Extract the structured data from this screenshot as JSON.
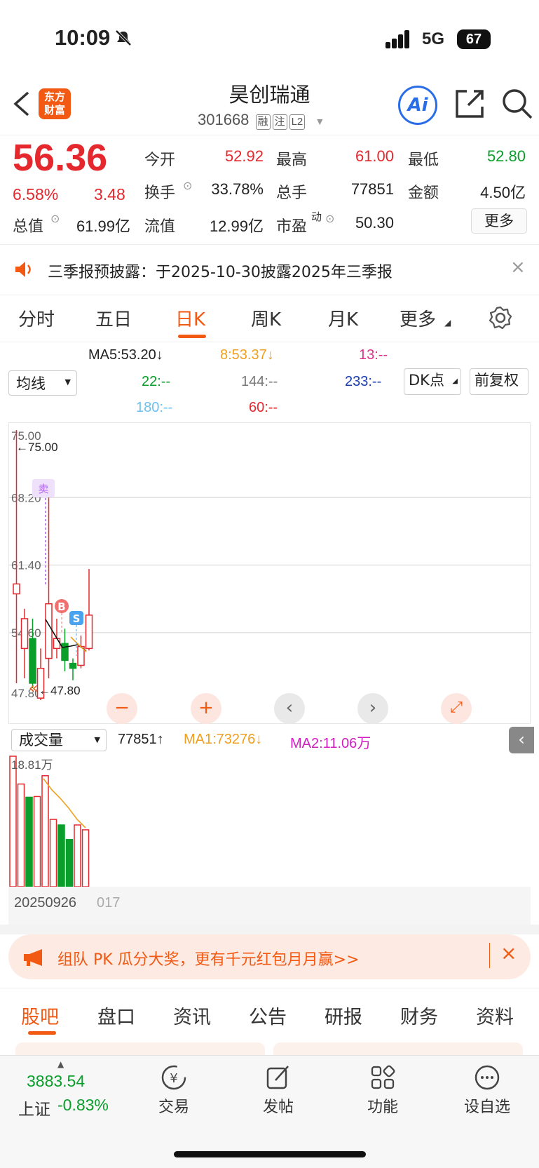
{
  "status": {
    "time": "10:09",
    "network": "5G",
    "battery": "67"
  },
  "header": {
    "logo": "东方财富",
    "name": "昊创瑞通",
    "code": "301668",
    "tags": [
      "融",
      "注",
      "L2"
    ],
    "ai": "Ai"
  },
  "quote": {
    "price": "56.36",
    "pct": "6.58%",
    "chg": "3.48",
    "open_l": "今开",
    "open": "52.92",
    "high_l": "最高",
    "high": "61.00",
    "low_l": "最低",
    "low": "52.80",
    "turn_l": "换手",
    "turn": "33.78%",
    "vol_l": "总手",
    "vol": "77851",
    "amt_l": "金额",
    "amt": "4.50亿",
    "cap_l": "总值",
    "cap": "61.99亿",
    "flt_l": "流值",
    "flt": "12.99亿",
    "pe_l": "市盈",
    "pe_sup": "动",
    "pe": "50.30",
    "more": "更多"
  },
  "notice": {
    "text": "三季报预披露：于2025-10-30披露2025年三季报"
  },
  "tabs": [
    "分时",
    "五日",
    "日K",
    "周K",
    "月K",
    "更多",
    "设置"
  ],
  "ma": {
    "ma5": "MA5:53.20↓",
    "ma8": "8:53.37↓",
    "ma13": "13:--",
    "ma22": "22:--",
    "ma144": "144:--",
    "ma233": "233:--",
    "ma180": "180:--",
    "ma60": "60:--",
    "sel": "均线",
    "dk": "DK点",
    "fq": "前复权"
  },
  "chart_data": {
    "type": "candlestick",
    "yticks": [
      "75.00",
      "68.20",
      "61.40",
      "54.60",
      "47.80"
    ],
    "ylim": [
      47.8,
      75.0
    ],
    "max_label": "←75.00",
    "min_label": "←47.80",
    "markers": [
      "B",
      "S",
      "卖"
    ],
    "candles": [
      {
        "o": 59.5,
        "c": 58.5,
        "h": 75.0,
        "l": 49.5,
        "up": true
      },
      {
        "o": 56,
        "c": 53,
        "h": 57,
        "l": 50,
        "up": true
      },
      {
        "o": 54,
        "c": 49.5,
        "h": 56,
        "l": 49,
        "up": false
      },
      {
        "o": 51,
        "c": 48,
        "h": 53,
        "l": 47.8,
        "up": true
      },
      {
        "o": 52,
        "c": 57.5,
        "h": 68.2,
        "l": 50,
        "up": true
      },
      {
        "o": 53,
        "c": 54,
        "h": 56,
        "l": 52,
        "up": true
      },
      {
        "o": 53.5,
        "c": 51.8,
        "h": 55,
        "l": 50.7,
        "up": false
      },
      {
        "o": 51.5,
        "c": 51,
        "h": 52,
        "l": 49.8,
        "up": false
      },
      {
        "o": 51.3,
        "c": 53.2,
        "h": 54.3,
        "l": 51,
        "up": true
      },
      {
        "o": 53,
        "c": 56.36,
        "h": 61,
        "l": 52.8,
        "up": true
      }
    ],
    "volume": {
      "label": "成交量",
      "cur": "77851↑",
      "ma1": "MA1:73276↓",
      "ma2": "MA2:11.06万",
      "max": "18.81万",
      "date": "20250926",
      "date2": "017",
      "bars": [
        18.81,
        14.8,
        12.9,
        13.0,
        16.0,
        9.7,
        8.9,
        6.8,
        8.9,
        8.2
      ]
    }
  },
  "promo": {
    "text": "组队 PK 瓜分大奖，更有千元红包月月赢>>"
  },
  "bottom_tabs": [
    "股吧",
    "盘口",
    "资讯",
    "公告",
    "研报",
    "财务",
    "资料"
  ],
  "dock": {
    "index_value": "3883.54",
    "index_name": "上证",
    "index_pct": "-0.83%",
    "items": [
      "交易",
      "发帖",
      "功能",
      "设自选"
    ]
  },
  "colors": {
    "up": "#e4282d",
    "down": "#0a9e2a",
    "accent": "#f25a14"
  }
}
